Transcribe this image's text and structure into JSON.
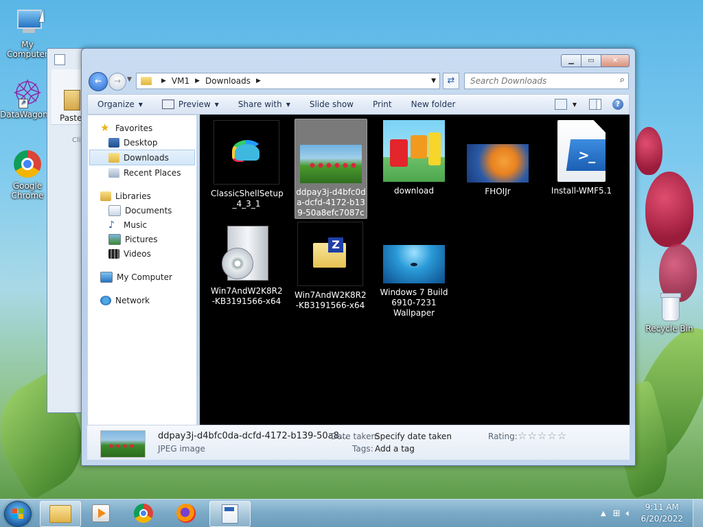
{
  "desktop": {
    "icons": [
      {
        "label": "My Computer"
      },
      {
        "label": "DataWagon..."
      },
      {
        "label": "Google Chrome"
      },
      {
        "label": "Recycle Bin"
      }
    ]
  },
  "background_window": {
    "paste_label": "Paste",
    "clipboard_label": "Cli"
  },
  "window": {
    "address": {
      "crumbs": [
        "VM1",
        "Downloads"
      ]
    },
    "search": {
      "placeholder": "Search Downloads"
    },
    "toolbar": {
      "organize": "Organize",
      "preview": "Preview",
      "share_with": "Share with",
      "slide_show": "Slide show",
      "print": "Print",
      "new_folder": "New folder"
    },
    "nav": {
      "favorites": "Favorites",
      "desktop": "Desktop",
      "downloads": "Downloads",
      "recent_places": "Recent Places",
      "libraries": "Libraries",
      "documents": "Documents",
      "music": "Music",
      "pictures": "Pictures",
      "videos": "Videos",
      "my_computer": "My Computer",
      "network": "Network"
    },
    "files": [
      {
        "line1": "ClassicShellSetup",
        "line2": "_4_3_1",
        "line3": ""
      },
      {
        "line1": "ddpay3j-d4bfc0d",
        "line2": "a-dcfd-4172-b13",
        "line3": "9-50a8efc7087c"
      },
      {
        "line1": "download",
        "line2": "",
        "line3": ""
      },
      {
        "line1": "FHOIJr",
        "line2": "",
        "line3": ""
      },
      {
        "line1": "Install-WMF5.1",
        "line2": "",
        "line3": ""
      },
      {
        "line1": "Win7AndW2K8R2",
        "line2": "-KB3191566-x64",
        "line3": ""
      },
      {
        "line1": "Win7AndW2K8R2",
        "line2": "-KB3191566-x64",
        "line3": ""
      },
      {
        "line1": "Windows 7 Build",
        "line2": "6910-7231",
        "line3": "Wallpaper"
      }
    ],
    "details": {
      "name": "ddpay3j-d4bfc0da-dcfd-4172-b139-50a8...",
      "type": "JPEG image",
      "date_taken_label": "Date taken:",
      "date_taken_value": "Specify date taken",
      "tags_label": "Tags:",
      "tags_value": "Add a tag",
      "rating_label": "Rating:",
      "rating_stars": "☆☆☆☆☆"
    }
  },
  "taskbar": {
    "time": "9:11 AM",
    "date": "6/20/2022"
  }
}
